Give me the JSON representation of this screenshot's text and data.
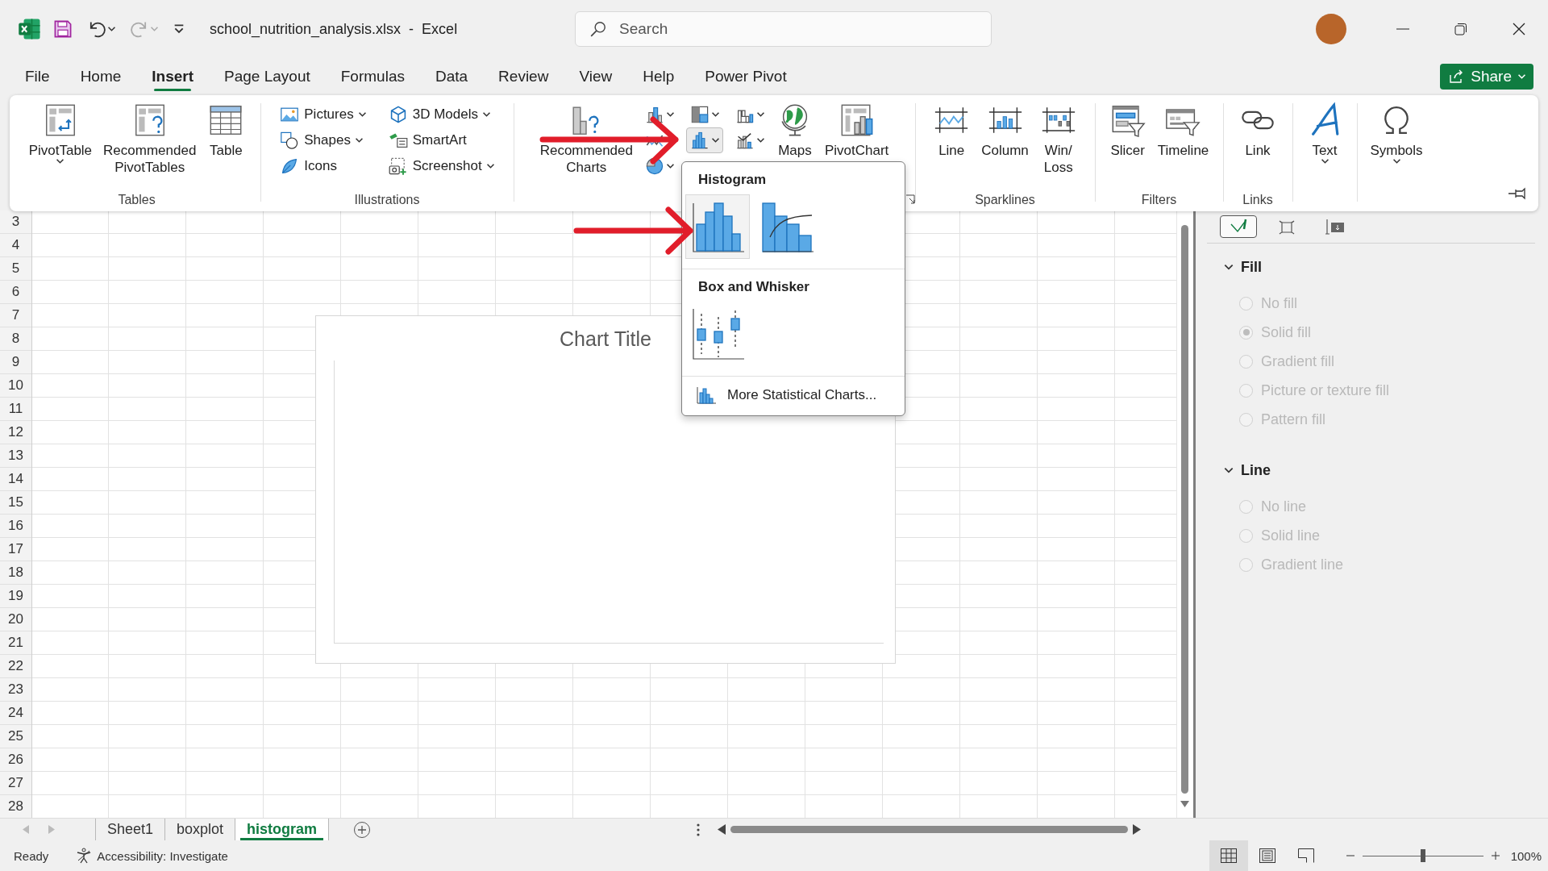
{
  "title_bar": {
    "quick_access": [
      {
        "kind": "save",
        "disabled": false
      },
      {
        "kind": "undo",
        "disabled": false
      },
      {
        "kind": "redo",
        "disabled": true
      },
      {
        "kind": "customize",
        "disabled": false
      }
    ],
    "title": "school_nutrition_analysis.xlsx  -  Excel",
    "search": {
      "placeholder": "Search"
    }
  },
  "menu": {
    "tabs": [
      {
        "label": "File",
        "selected": false
      },
      {
        "label": "Home",
        "selected": false
      },
      {
        "label": "Insert",
        "selected": true
      },
      {
        "label": "Page Layout",
        "selected": false
      },
      {
        "label": "Formulas",
        "selected": false
      },
      {
        "label": "Data",
        "selected": false
      },
      {
        "label": "Review",
        "selected": false
      },
      {
        "label": "View",
        "selected": false
      },
      {
        "label": "Help",
        "selected": false
      },
      {
        "label": "Power Pivot",
        "selected": false
      }
    ],
    "share_button": "Share"
  },
  "ribbon": {
    "groups": [
      {
        "label": "Tables",
        "items": [
          {
            "kind": "large",
            "label": "PivotTable",
            "dropdown": true
          },
          {
            "kind": "large",
            "label": "Recommended PivotTables",
            "dropdown": false
          },
          {
            "kind": "large",
            "label": "Table",
            "dropdown": false
          }
        ]
      },
      {
        "label": "Illustrations",
        "items": [
          {
            "kind": "small",
            "label": "Pictures",
            "dropdown": true
          },
          {
            "kind": "small",
            "label": "Shapes",
            "dropdown": true
          },
          {
            "kind": "small",
            "label": "Icons",
            "dropdown": false
          },
          {
            "kind": "small",
            "label": "3D Models",
            "dropdown": true
          },
          {
            "kind": "small",
            "label": "SmartArt",
            "dropdown": false
          },
          {
            "kind": "small",
            "label": "Screenshot",
            "dropdown": true
          }
        ]
      },
      {
        "launcher": true,
        "items": [
          {
            "kind": "large",
            "label": "Recommended Charts",
            "dropdown": false
          },
          {
            "kind": "icon",
            "dropdown": true,
            "selected": false
          },
          {
            "kind": "icon",
            "dropdown": true,
            "selected": false
          },
          {
            "kind": "icon",
            "dropdown": true,
            "selected": false
          },
          {
            "kind": "icon",
            "dropdown": false,
            "selected": false
          },
          {
            "kind": "icon",
            "dropdown": true,
            "selected": true
          },
          {
            "kind": "icon",
            "dropdown": true,
            "selected": false
          },
          {
            "kind": "icon",
            "dropdown": true,
            "selected": false
          },
          {
            "kind": "large",
            "label": "Maps",
            "dropdown": false
          },
          {
            "kind": "large",
            "label": "PivotChart",
            "dropdown": false
          }
        ]
      },
      {
        "label": "Sparklines",
        "items": [
          {
            "kind": "large",
            "label": "Line",
            "dropdown": false
          },
          {
            "kind": "large",
            "label": "Column",
            "dropdown": false
          },
          {
            "kind": "large",
            "label": "Win/ Loss",
            "dropdown": false
          }
        ]
      },
      {
        "label": "Filters",
        "items": [
          {
            "kind": "large",
            "label": "Slicer",
            "dropdown": false
          },
          {
            "kind": "large",
            "label": "Timeline",
            "dropdown": false
          }
        ]
      },
      {
        "label": "Links",
        "items": [
          {
            "kind": "large",
            "label": "Link",
            "dropdown": false
          }
        ]
      },
      {
        "items": [
          {
            "kind": "large",
            "label": "Text",
            "dropdown": true
          }
        ]
      },
      {
        "items": [
          {
            "kind": "large",
            "label": "Symbols",
            "dropdown": true
          }
        ]
      }
    ]
  },
  "sheet": {
    "row_numbers": [
      "3",
      "4",
      "5",
      "6",
      "7",
      "8",
      "9",
      "10",
      "11",
      "12",
      "13",
      "14",
      "15",
      "16",
      "17",
      "18",
      "19",
      "20",
      "21",
      "22",
      "23",
      "24",
      "25",
      "26",
      "27",
      "28"
    ],
    "chart": {
      "title": "Chart Title"
    }
  },
  "chart_type_menu": {
    "sections": [
      {
        "title": "Histogram",
        "options": [
          {
            "selected": true
          },
          {
            "selected": false
          }
        ]
      },
      {
        "title": "Box and Whisker",
        "options": [
          {
            "selected": false
          }
        ]
      }
    ],
    "footer_link": "More Statistical Charts..."
  },
  "format_pane": {
    "tabs": [
      {
        "selected": true
      },
      {
        "selected": false
      },
      {
        "selected": false
      }
    ],
    "sections": [
      {
        "title": "Fill",
        "expanded": true,
        "options": [
          {
            "label": "No fill",
            "selected": false,
            "disabled": true
          },
          {
            "label": "Solid fill",
            "selected": true,
            "disabled": true
          },
          {
            "label": "Gradient fill",
            "selected": false,
            "disabled": true
          },
          {
            "label": "Picture or texture fill",
            "selected": false,
            "disabled": true
          },
          {
            "label": "Pattern fill",
            "selected": false,
            "disabled": true
          }
        ]
      },
      {
        "title": "Line",
        "expanded": true,
        "options": [
          {
            "label": "No line",
            "selected": false,
            "disabled": true
          },
          {
            "label": "Solid line",
            "selected": false,
            "disabled": true
          },
          {
            "label": "Gradient line",
            "selected": false,
            "disabled": true
          }
        ]
      }
    ]
  },
  "sheet_tabs": [
    {
      "label": "Sheet1",
      "selected": false
    },
    {
      "label": "boxplot",
      "selected": false
    },
    {
      "label": "histogram",
      "selected": true
    }
  ],
  "status_bar": {
    "status": "Ready",
    "accessibility": "Accessibility: Investigate",
    "views": [
      {
        "selected": true
      },
      {
        "selected": false
      },
      {
        "selected": false
      }
    ],
    "zoom": {
      "level": 0.5,
      "reading": "100%"
    }
  }
}
